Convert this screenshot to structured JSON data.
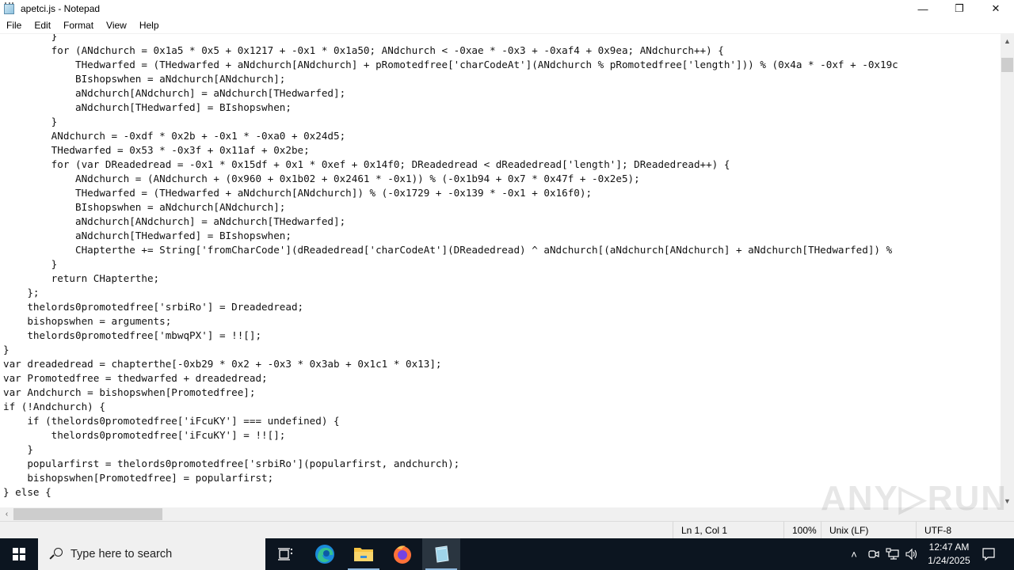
{
  "window": {
    "title": "apetci.js - Notepad",
    "controls": {
      "minimize": "—",
      "maximize": "❐",
      "close": "✕"
    }
  },
  "menu": [
    "File",
    "Edit",
    "Format",
    "View",
    "Help"
  ],
  "editor": {
    "lines": [
      "        }",
      "        for (ANdchurch = 0x1a5 * 0x5 + 0x1217 + -0x1 * 0x1a50; ANdchurch < -0xae * -0x3 + -0xaf4 + 0x9ea; ANdchurch++) {",
      "            THedwarfed = (THedwarfed + aNdchurch[ANdchurch] + pRomotedfree['charCodeAt'](ANdchurch % pRomotedfree['length'])) % (0x4a * -0xf + -0x19c",
      "            BIshopswhen = aNdchurch[ANdchurch];",
      "            aNdchurch[ANdchurch] = aNdchurch[THedwarfed];",
      "            aNdchurch[THedwarfed] = BIshopswhen;",
      "        }",
      "        ANdchurch = -0xdf * 0x2b + -0x1 * -0xa0 + 0x24d5;",
      "        THedwarfed = 0x53 * -0x3f + 0x11af + 0x2be;",
      "        for (var DReadedread = -0x1 * 0x15df + 0x1 * 0xef + 0x14f0; DReadedread < dReadedread['length']; DReadedread++) {",
      "            ANdchurch = (ANdchurch + (0x960 + 0x1b02 + 0x2461 * -0x1)) % (-0x1b94 + 0x7 * 0x47f + -0x2e5);",
      "            THedwarfed = (THedwarfed + aNdchurch[ANdchurch]) % (-0x1729 + -0x139 * -0x1 + 0x16f0);",
      "            BIshopswhen = aNdchurch[ANdchurch];",
      "            aNdchurch[ANdchurch] = aNdchurch[THedwarfed];",
      "            aNdchurch[THedwarfed] = BIshopswhen;",
      "            CHapterthe += String['fromCharCode'](dReadedread['charCodeAt'](DReadedread) ^ aNdchurch[(aNdchurch[ANdchurch] + aNdchurch[THedwarfed]) %",
      "        }",
      "        return CHapterthe;",
      "    };",
      "    thelords0promotedfree['srbiRo'] = Dreadedread;",
      "    bishopswhen = arguments;",
      "    thelords0promotedfree['mbwqPX'] = !![];",
      "}",
      "var dreadedread = chapterthe[-0xb29 * 0x2 + -0x3 * 0x3ab + 0x1c1 * 0x13];",
      "var Promotedfree = thedwarfed + dreadedread;",
      "var Andchurch = bishopswhen[Promotedfree];",
      "if (!Andchurch) {",
      "    if (thelords0promotedfree['iFcuKY'] === undefined) {",
      "        thelords0promotedfree['iFcuKY'] = !![];",
      "    }",
      "    popularfirst = thelords0promotedfree['srbiRo'](popularfirst, andchurch);",
      "    bishopswhen[Promotedfree] = popularfirst;",
      "} else {"
    ]
  },
  "statusbar": {
    "position": "Ln 1, Col 1",
    "zoom": "100%",
    "line_ending": "Unix (LF)",
    "encoding": "UTF-8"
  },
  "watermark": "ANY▷RUN",
  "taskbar": {
    "search_placeholder": "Type here to search",
    "apps": [
      "task-view",
      "edge",
      "file-explorer",
      "firefox",
      "notepad"
    ],
    "clock_time": "12:47 AM",
    "clock_date": "1/24/2025"
  }
}
